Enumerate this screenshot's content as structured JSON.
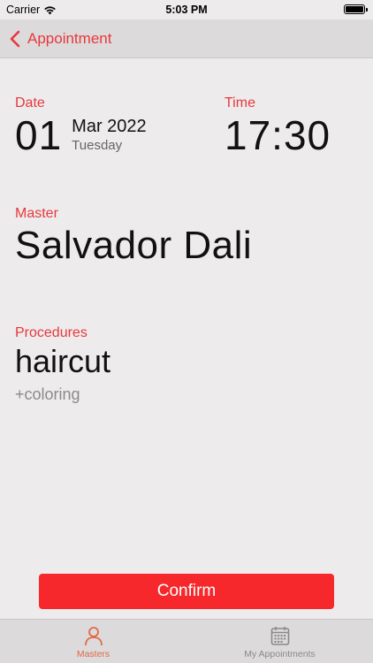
{
  "status_bar": {
    "carrier": "Carrier",
    "time": "5:03 PM"
  },
  "nav": {
    "back_label": "Appointment"
  },
  "date": {
    "label": "Date",
    "day": "01",
    "month_year": "Mar 2022",
    "weekday": "Tuesday"
  },
  "time": {
    "label": "Time",
    "value": "17:30"
  },
  "master": {
    "label": "Master",
    "name": "Salvador Dali"
  },
  "procedures": {
    "label": "Procedures",
    "main": "haircut",
    "extra": "+coloring"
  },
  "confirm": {
    "label": "Confirm"
  },
  "tabs": [
    {
      "label": "Masters",
      "icon": "person-icon",
      "active": true
    },
    {
      "label": "My Appointments",
      "icon": "calendar-icon",
      "active": false
    }
  ],
  "colors": {
    "accent": "#e8383c",
    "button": "#f7282b",
    "active_tab": "#e06a47"
  }
}
